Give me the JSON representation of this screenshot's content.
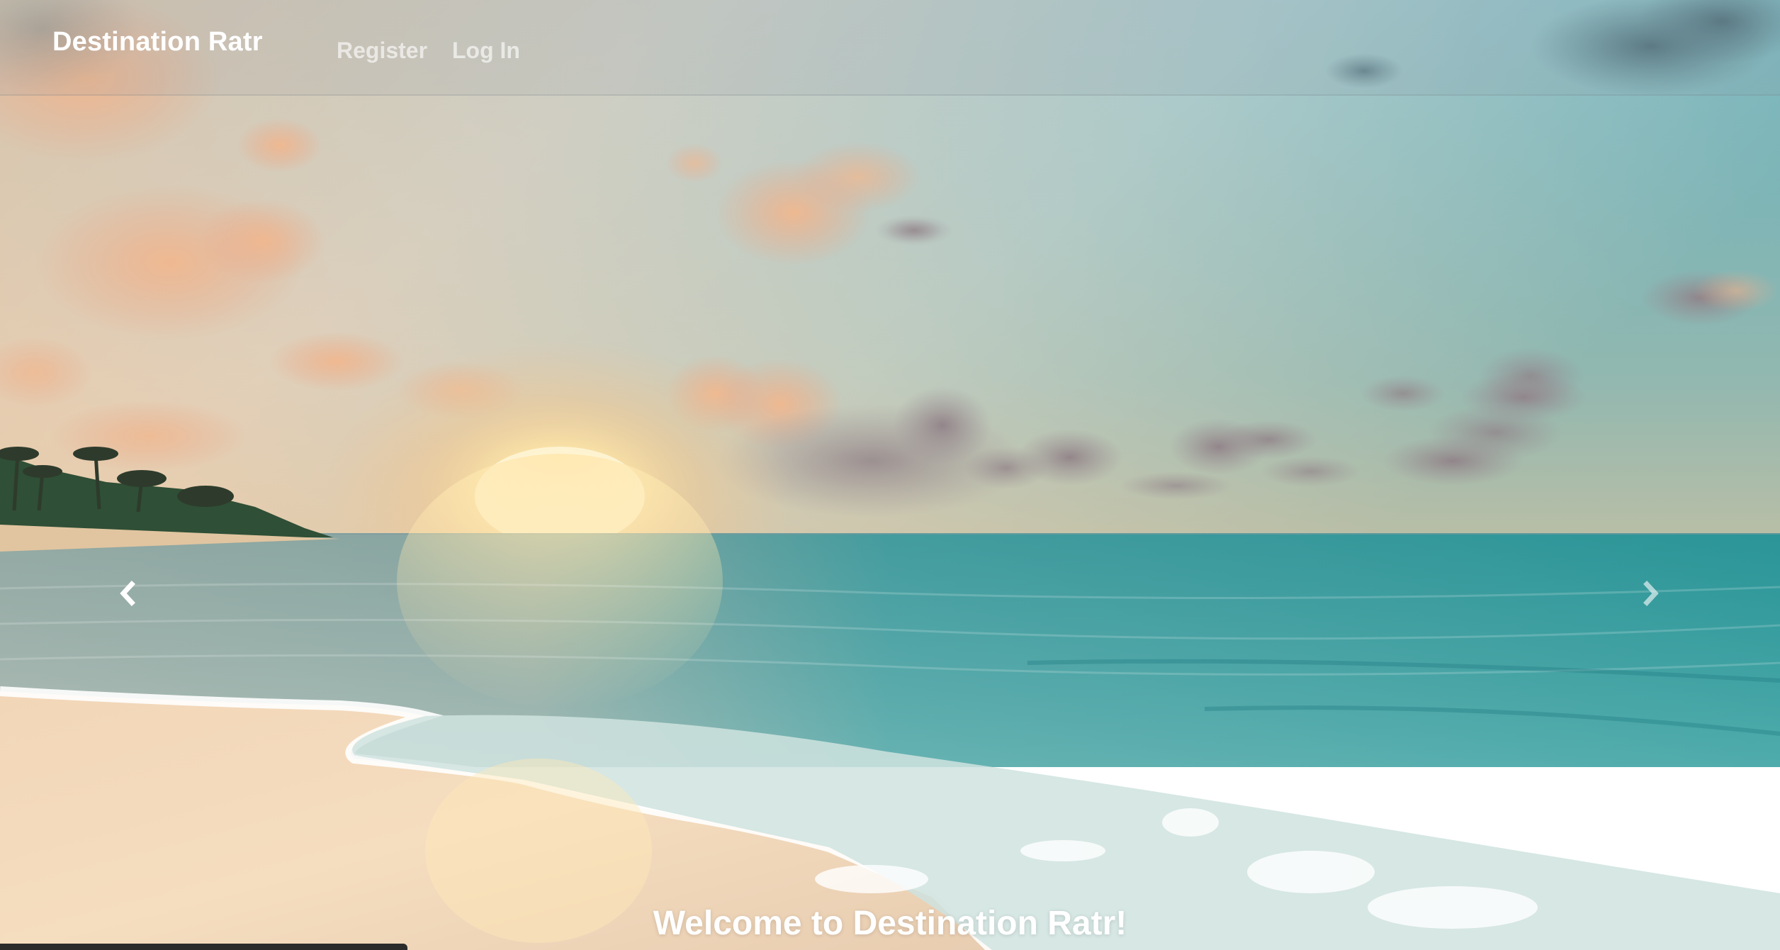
{
  "navbar": {
    "brand": "Destination Ratr",
    "links": [
      {
        "label": "Register"
      },
      {
        "label": "Log In"
      }
    ]
  },
  "carousel": {
    "prev_icon": "chevron-left-icon",
    "next_icon": "chevron-right-icon",
    "slide_description_colors": {
      "sky_top": "#6fb3bb",
      "sun": "#fff3c4",
      "sea": "#3aa6a4",
      "sand": "#f1d7b5"
    }
  },
  "hero": {
    "heading": "Welcome to Destination Ratr!"
  }
}
